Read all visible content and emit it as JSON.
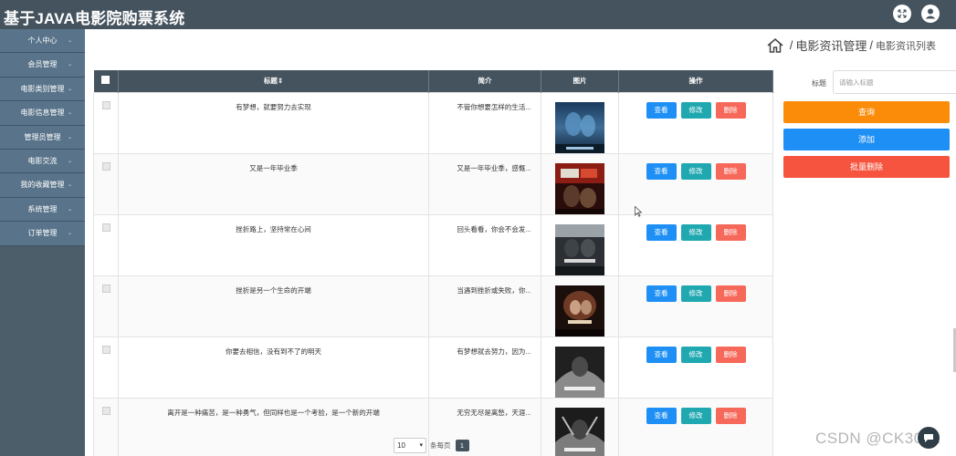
{
  "app": {
    "title": "基于JAVA电影院购票系统"
  },
  "topbar": {
    "fullscreen_icon": "fullscreen-icon",
    "user_icon": "user-icon"
  },
  "sidebar": {
    "items": [
      {
        "label": "个人中心"
      },
      {
        "label": "会员管理"
      },
      {
        "label": "电影类别管理"
      },
      {
        "label": "电影信息管理"
      },
      {
        "label": "管理员管理"
      },
      {
        "label": "电影交流"
      },
      {
        "label": "我的收藏管理"
      },
      {
        "label": "系统管理"
      },
      {
        "label": "订单管理"
      }
    ]
  },
  "breadcrumb": {
    "separator": "/",
    "items": [
      "电影资讯管理",
      "电影资讯列表"
    ]
  },
  "table": {
    "columns": [
      "标题⇕",
      "简介",
      "图片",
      "操作"
    ],
    "action_labels": {
      "view": "查看",
      "edit": "修改",
      "delete": "删除"
    },
    "rows": [
      {
        "title": "有梦想，就要努力去实现",
        "intro": "不管你想要怎样的生活..."
      },
      {
        "title": "又是一年毕业季",
        "intro": "又是一年毕业季，感慨..."
      },
      {
        "title": "挫折路上，坚持常在心间",
        "intro": "回头看看，你会不会发..."
      },
      {
        "title": "挫折是另一个生命的开端",
        "intro": "当遇到挫折或失败，你..."
      },
      {
        "title": "你要去相信，没有到不了的明天",
        "intro": "有梦想就去努力，因为..."
      },
      {
        "title": "离开是一种痛苦，是一种勇气，但同样也是一个考验，是一个新的开端",
        "intro": "无穷无尽是离愁，天涯..."
      }
    ]
  },
  "search": {
    "label": "标题",
    "placeholder": "请输入标题",
    "query_label": "查询",
    "add_label": "添加",
    "batch_delete_label": "批量删除"
  },
  "pagination": {
    "page_size": "10",
    "per_page_label": "条每页",
    "current_page": "1"
  },
  "watermark": "CSDN @CK3041",
  "colors": {
    "header": "#45535e",
    "sidebar": "#59748a",
    "view": "#1e8ff5",
    "edit": "#1fa8b0",
    "delete": "#f6695a",
    "query": "#fa8c0a",
    "batch_delete": "#f6543f"
  }
}
